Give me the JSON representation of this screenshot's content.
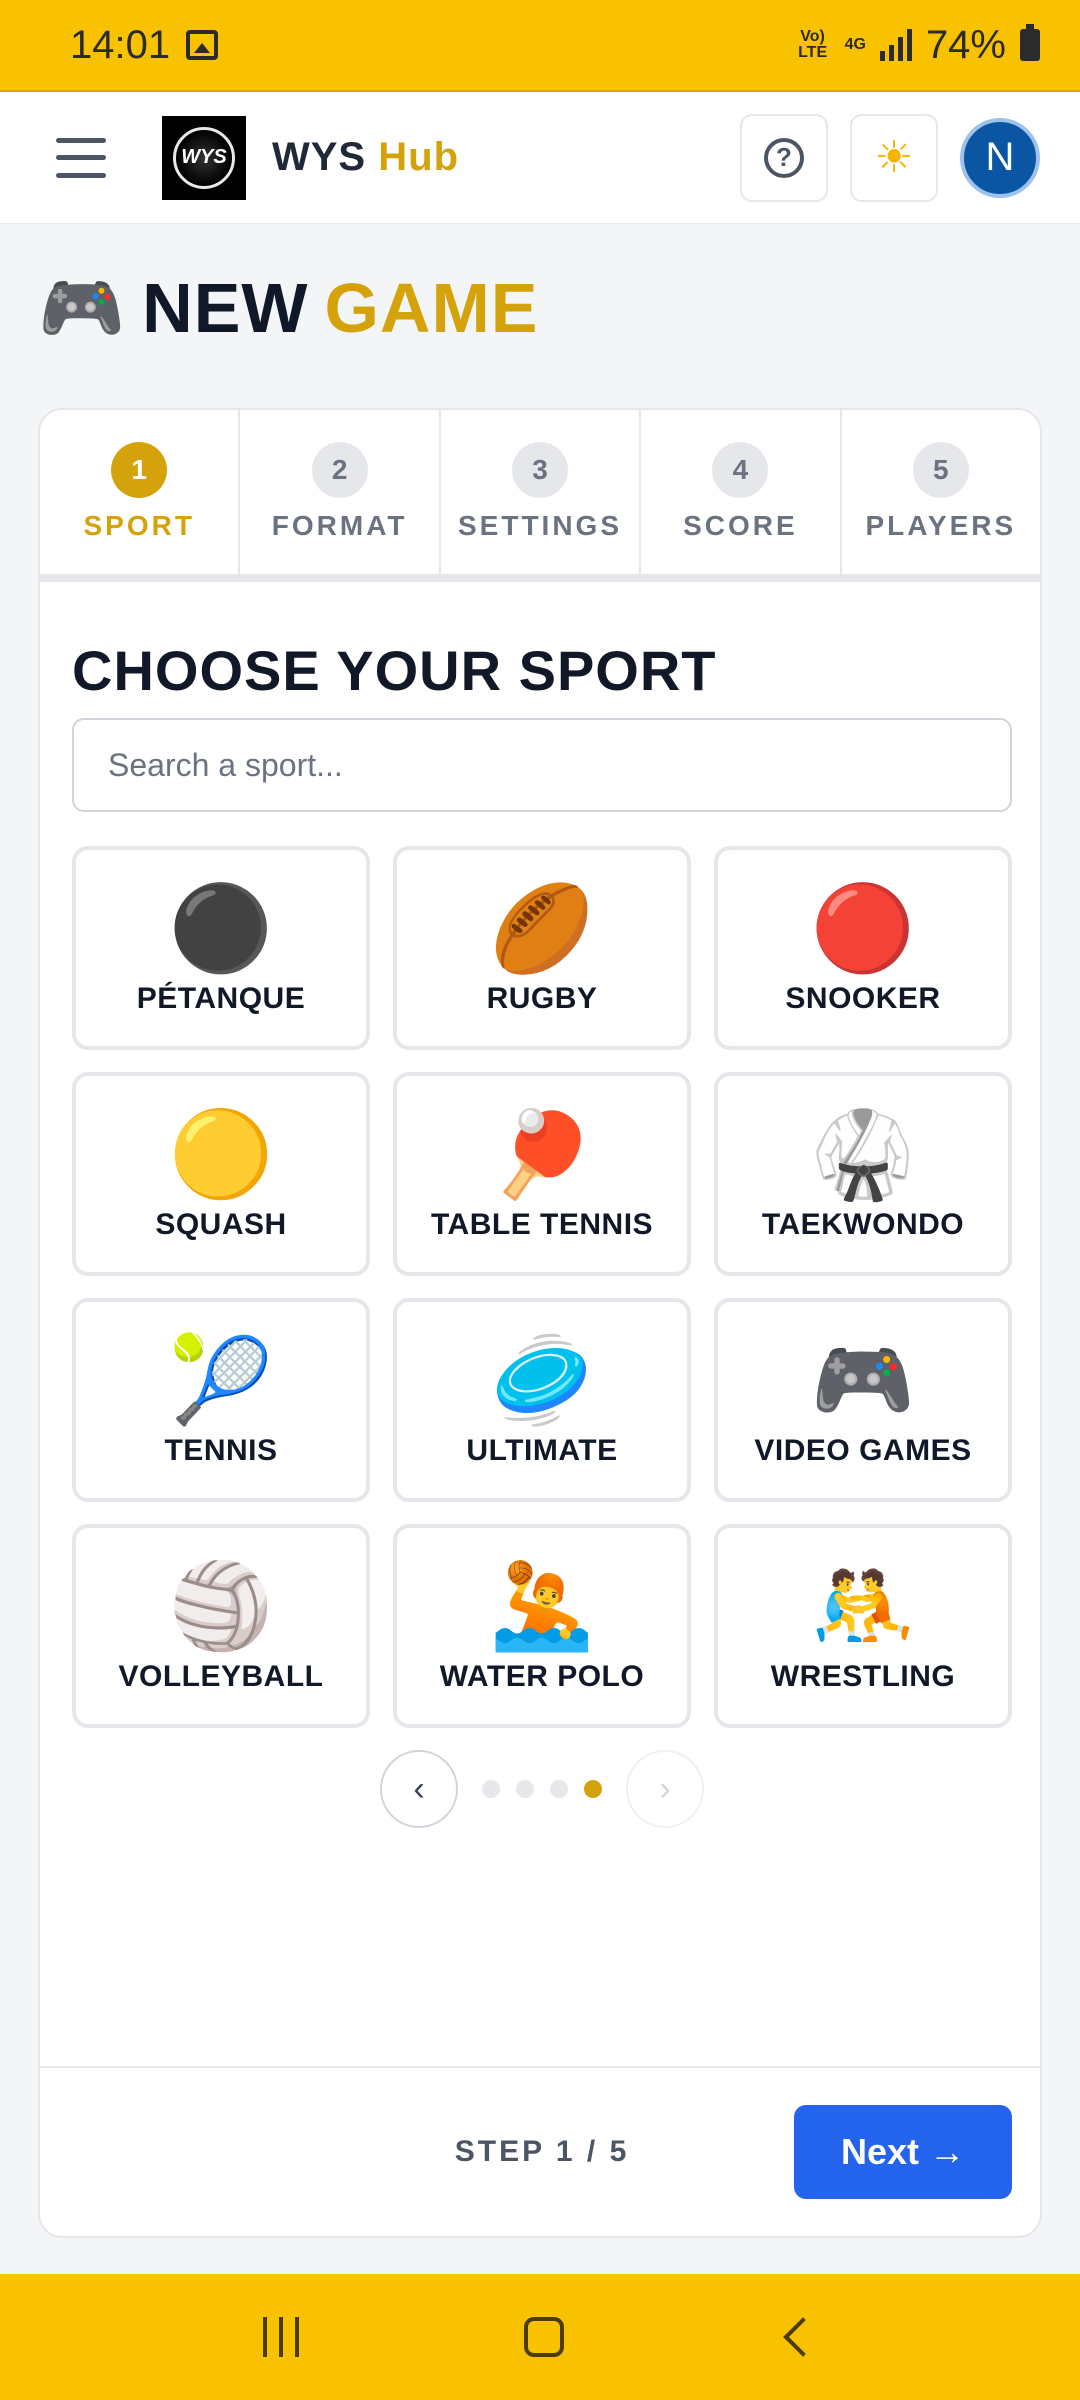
{
  "status_bar": {
    "time": "14:01",
    "network_top": "Vo) LTE",
    "network_4g": "4G",
    "battery": "74%"
  },
  "header": {
    "logo_text": "WYS",
    "brand_main": "WYS",
    "brand_accent": "Hub",
    "help_icon": "?",
    "theme_icon": "☀",
    "avatar_initial": "N"
  },
  "page": {
    "title_icon": "🎮",
    "title_main": "NEW",
    "title_accent": "GAME"
  },
  "stepper": [
    {
      "num": "1",
      "label": "SPORT",
      "active": true
    },
    {
      "num": "2",
      "label": "FORMAT"
    },
    {
      "num": "3",
      "label": "SETTINGS"
    },
    {
      "num": "4",
      "label": "SCORE"
    },
    {
      "num": "5",
      "label": "PLAYERS"
    }
  ],
  "section": {
    "title": "CHOOSE YOUR SPORT",
    "search_placeholder": "Search a sport..."
  },
  "sports": [
    {
      "emoji": "⚫",
      "label": "PÉTANQUE"
    },
    {
      "emoji": "🏉",
      "label": "RUGBY"
    },
    {
      "emoji": "🔴",
      "label": "SNOOKER"
    },
    {
      "emoji": "🟡",
      "label": "SQUASH"
    },
    {
      "emoji": "🏓",
      "label": "TABLE TENNIS"
    },
    {
      "emoji": "🥋",
      "label": "TAEKWONDO"
    },
    {
      "emoji": "🎾",
      "label": "TENNIS"
    },
    {
      "emoji": "🥏",
      "label": "ULTIMATE"
    },
    {
      "emoji": "🎮",
      "label": "VIDEO GAMES"
    },
    {
      "emoji": "🏐",
      "label": "VOLLEYBALL"
    },
    {
      "emoji": "🤽",
      "label": "WATER POLO"
    },
    {
      "emoji": "🤼",
      "label": "WRESTLING"
    }
  ],
  "pager": {
    "prev": "‹",
    "next": "›",
    "pages": 4,
    "current": 4
  },
  "footer": {
    "step_counter": "STEP 1 / 5",
    "next_label": "Next →"
  },
  "colors": {
    "accent_gold": "#d4a20a",
    "status_bar": "#f8c200",
    "primary_blue": "#2463eb",
    "avatar_blue": "#0b56a3"
  }
}
